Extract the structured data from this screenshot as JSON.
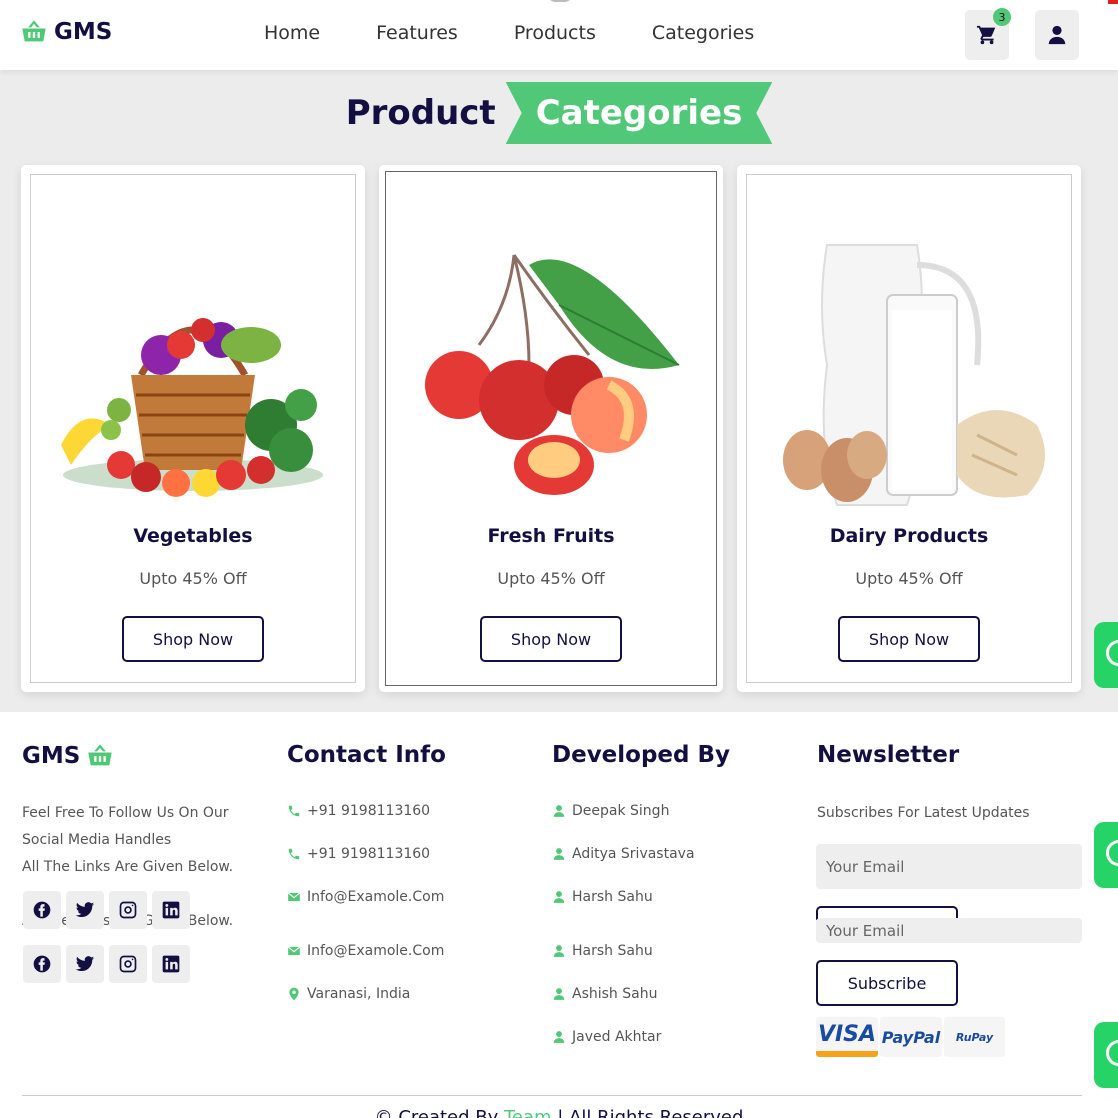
{
  "header": {
    "brand": "GMS",
    "nav": [
      "Home",
      "Features",
      "Products",
      "Categories"
    ],
    "cart_count": "3"
  },
  "section": {
    "title_plain": "Product",
    "title_highlight": "Categories"
  },
  "categories": [
    {
      "name": "Vegetables",
      "discount": "Upto 45% Off",
      "button": "Shop Now",
      "image": "vegetable-basket-image"
    },
    {
      "name": "Fresh Fruits",
      "discount": "Upto 45% Off",
      "button": "Shop Now",
      "image": "cherries-image"
    },
    {
      "name": "Dairy Products",
      "discount": "Upto 45% Off",
      "button": "Shop Now",
      "image": "milk-eggs-bread-image"
    }
  ],
  "footer": {
    "brand": "GMS",
    "about": [
      "Feel Free To Follow Us On Our",
      "Social Media Handles",
      "All The Links Are Given Below.",
      "All The Links Are Given Below."
    ],
    "social": [
      "facebook-icon",
      "twitter-icon",
      "instagram-icon",
      "linkedin-icon"
    ],
    "contact_title": "Contact Info",
    "contact": [
      {
        "icon": "phone-icon",
        "text": "+91 9198113160"
      },
      {
        "icon": "phone-icon",
        "text": "+91 9198113160"
      },
      {
        "icon": "envelope-icon",
        "text": "Info@Examole.Com"
      },
      {
        "icon": "envelope-icon",
        "text": "Info@Examole.Com"
      },
      {
        "icon": "map-pin-icon",
        "text": "Varanasi, India"
      }
    ],
    "dev_title": "Developed By",
    "developers": [
      "Deepak Singh",
      "Aditya Srivastava",
      "Harsh Sahu",
      "Harsh Sahu",
      "Ashish Sahu",
      "Javed Akhtar"
    ],
    "newsletter_title": "Newsletter",
    "newsletter_text": "Subscribes For Latest Updates",
    "email_placeholder": "Your Email",
    "subscribe": "Subscribe",
    "payments": [
      "VISA",
      "PayPal",
      "RuPay"
    ],
    "credit_prefix": "© Created By ",
    "credit_name": "Team",
    "credit_suffix": " | All Rights Reserved"
  },
  "colors": {
    "accent": "#51c878",
    "dark": "#130f40",
    "bg": "#ececec"
  }
}
